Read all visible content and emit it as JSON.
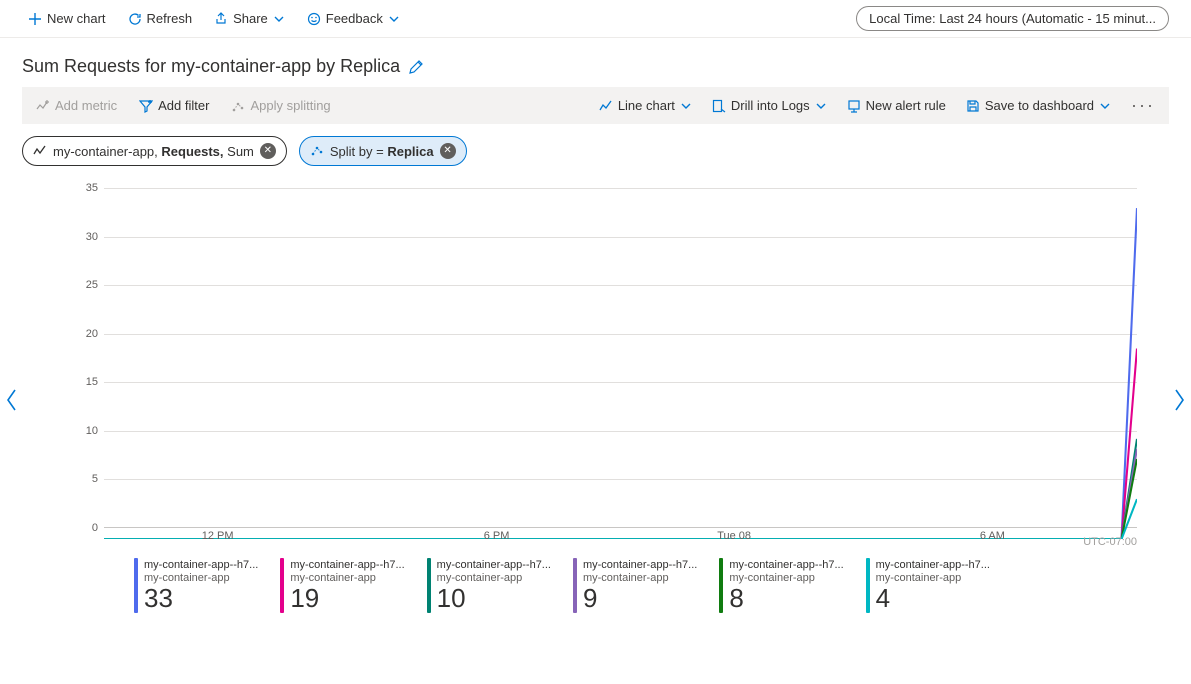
{
  "commands": {
    "new_chart": "New chart",
    "refresh": "Refresh",
    "share": "Share",
    "feedback": "Feedback",
    "time_range": "Local Time: Last 24 hours (Automatic - 15 minut..."
  },
  "chart_title": "Sum Requests for my-container-app by Replica",
  "filterbar": {
    "add_metric": "Add metric",
    "add_filter": "Add filter",
    "apply_splitting": "Apply splitting",
    "line_chart": "Line chart",
    "drill_logs": "Drill into Logs",
    "new_alert": "New alert rule",
    "save_dash": "Save to dashboard"
  },
  "pills": {
    "metric_prefix": "my-container-app, ",
    "metric_bold": "Requests,",
    "metric_suffix": " Sum",
    "split_prefix": "Split by = ",
    "split_bold": "Replica"
  },
  "chart_data": {
    "type": "line",
    "title": "Sum Requests for my-container-app by Replica",
    "ylabel": "",
    "xlabel": "",
    "ylim": [
      0,
      35
    ],
    "yticks": [
      0,
      5,
      10,
      15,
      20,
      25,
      30,
      35
    ],
    "xticks": [
      "12 PM",
      "6 PM",
      "Tue 08",
      "6 AM"
    ],
    "timezone": "UTC-07:00",
    "series": [
      {
        "name": "my-container-app--h7...",
        "sub": "my-container-app",
        "value": 33,
        "color": "#4f6bed"
      },
      {
        "name": "my-container-app--h7...",
        "sub": "my-container-app",
        "value": 19,
        "color": "#e3008c"
      },
      {
        "name": "my-container-app--h7...",
        "sub": "my-container-app",
        "value": 10,
        "color": "#008272"
      },
      {
        "name": "my-container-app--h7...",
        "sub": "my-container-app",
        "value": 9,
        "color": "#8764b8"
      },
      {
        "name": "my-container-app--h7...",
        "sub": "my-container-app",
        "value": 8,
        "color": "#107c10"
      },
      {
        "name": "my-container-app--h7...",
        "sub": "my-container-app",
        "value": 4,
        "color": "#00b7c3"
      }
    ],
    "note": "All series flat at 0 across the 24-hour window except a spike at the rightmost point to the respective value."
  }
}
